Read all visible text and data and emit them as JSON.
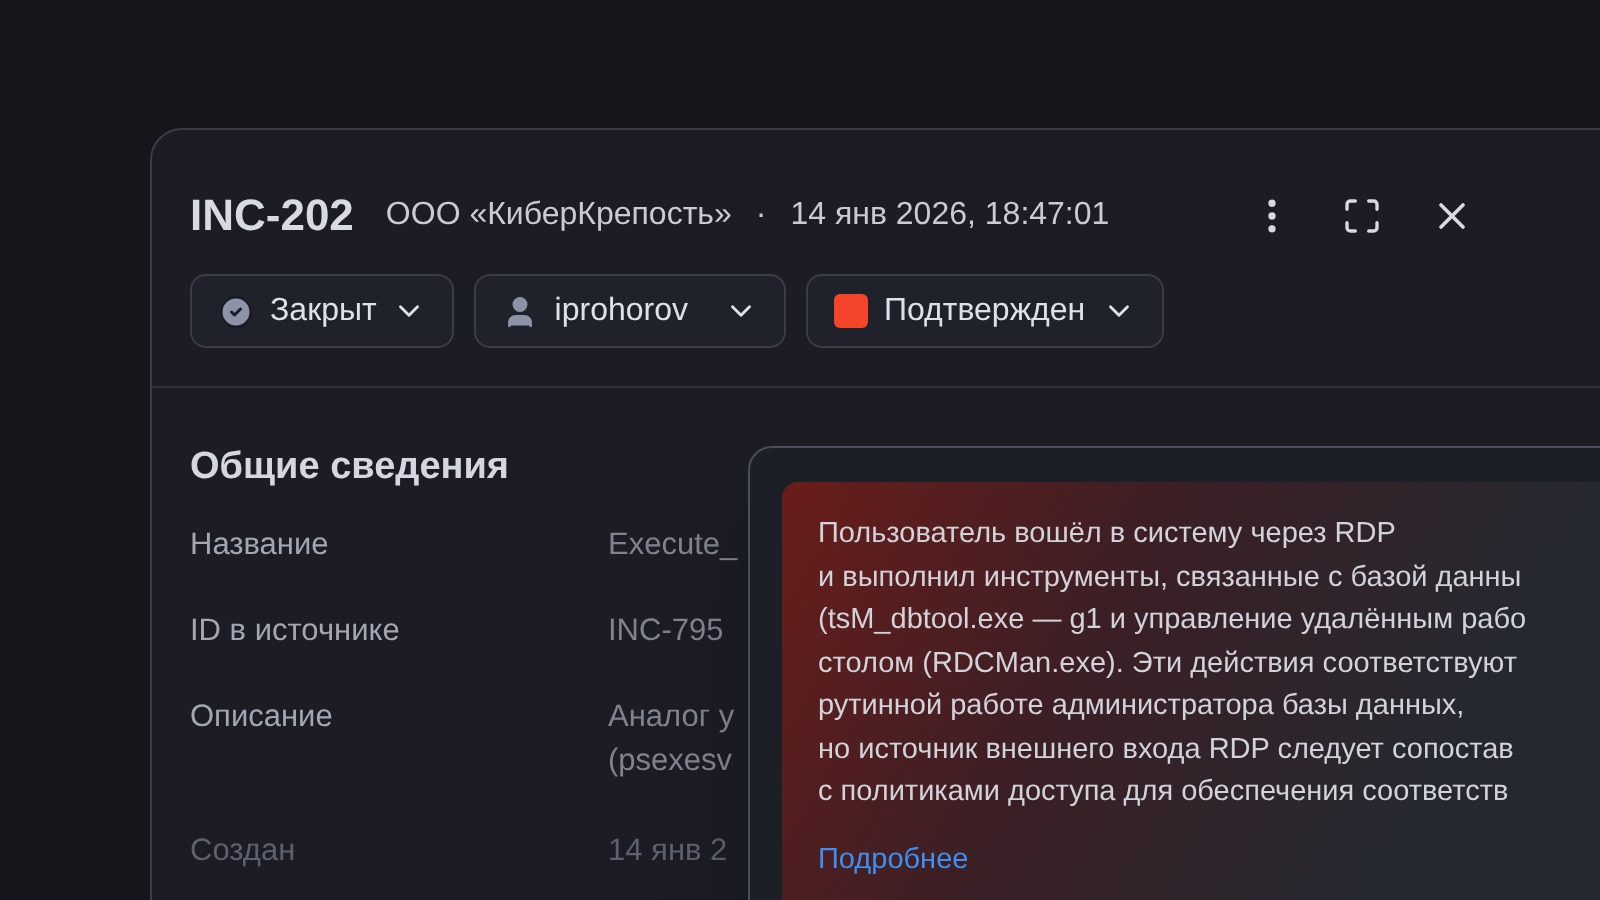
{
  "incident": {
    "id": "INC-202",
    "organization": "ООО «КиберКрепость»",
    "separator": "·",
    "timestamp": "14 янв 2026, 18:47:01"
  },
  "chips": [
    {
      "kind": "status",
      "label": "Закрыт"
    },
    {
      "kind": "user",
      "label": "iprohorov"
    },
    {
      "kind": "verdict",
      "label": "Подтвержден",
      "color": "#f4452b"
    }
  ],
  "section": {
    "title": "Общие сведения",
    "fields": [
      {
        "label": "Название",
        "value": [
          "Execute_"
        ]
      },
      {
        "label": "ID в источнике",
        "value": [
          "INC-795"
        ]
      },
      {
        "label": "Описание",
        "value": [
          "Аналог у",
          "(psexesv"
        ]
      },
      {
        "label": "Создан",
        "value": [
          "14 янв 2"
        ]
      }
    ]
  },
  "popup": {
    "lines": [
      "Пользователь вошёл в систему через RDP",
      "и выполнил инструменты, связанные с базой данны",
      "(tsM_dbtool.exe — g1 и управление удалённым рабо",
      "столом (RDCMan.exe). Эти действия соответствуют",
      "рутинной работе администратора базы данных,",
      "но источник внешнего входа RDP следует сопостав",
      "с политиками доступа для обеспечения соответств"
    ],
    "link": "Подробнее"
  }
}
